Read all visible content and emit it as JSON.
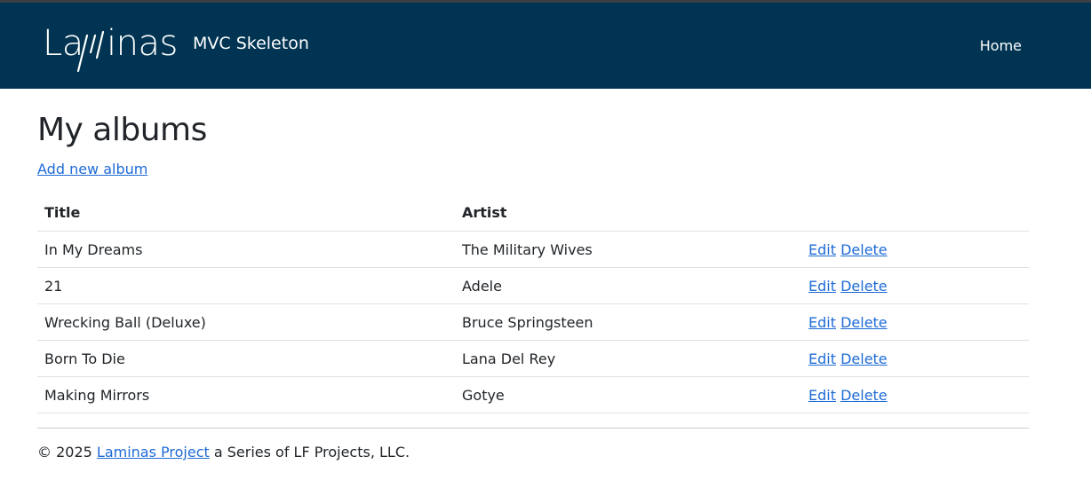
{
  "header": {
    "brand_name": "Laminas",
    "brand_subtitle": "MVC Skeleton",
    "nav_home": "Home",
    "background_color": "#003452"
  },
  "main": {
    "title": "My albums",
    "add_link": "Add new album",
    "table": {
      "headers": [
        "Title",
        "Artist",
        ""
      ],
      "rows": [
        {
          "title": "In My Dreams",
          "artist": "The Military Wives",
          "edit": "Edit",
          "delete": "Delete"
        },
        {
          "title": "21",
          "artist": "Adele",
          "edit": "Edit",
          "delete": "Delete"
        },
        {
          "title": "Wrecking Ball (Deluxe)",
          "artist": "Bruce Springsteen",
          "edit": "Edit",
          "delete": "Delete"
        },
        {
          "title": "Born To Die",
          "artist": "Lana Del Rey",
          "edit": "Edit",
          "delete": "Delete"
        },
        {
          "title": "Making Mirrors",
          "artist": "Gotye",
          "edit": "Edit",
          "delete": "Delete"
        }
      ]
    }
  },
  "footer": {
    "copyright": "© 2025",
    "project_link": "Laminas Project",
    "suffix": "a Series of LF Projects, LLC."
  },
  "colors": {
    "link": "#1e6bd6",
    "header_bg": "#003452",
    "text": "#212529"
  }
}
